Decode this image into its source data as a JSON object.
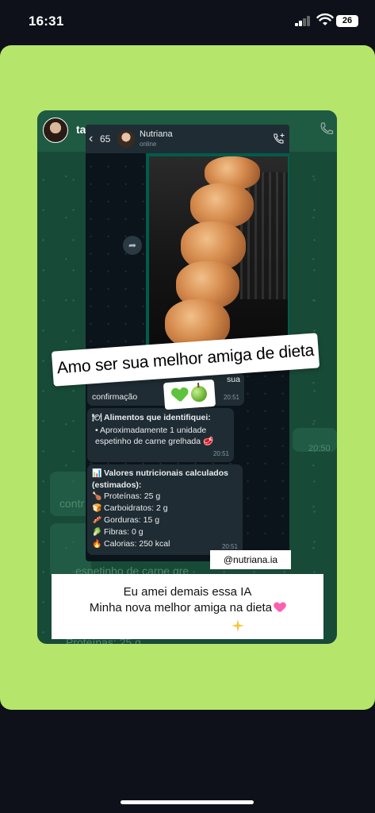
{
  "status_bar": {
    "time": "16:31",
    "battery": "26"
  },
  "story": {
    "username": "tainahvitral",
    "caption_top": "Amo ser sua melhor amiga de dieta",
    "caption_emojis": [
      "green-heart",
      "green-apple"
    ],
    "handle": "@nutriana.ia",
    "caption_bottom_line1": "Eu amei demais essa IA",
    "caption_bottom_line2": "Minha nova melhor amiga na dieta",
    "background_color": "#b5e56a"
  },
  "whatsapp_bg": {
    "back_count": "65",
    "time_right": "20:50",
    "ghost_lines": [
      "contr",
      "espetinho de carne gre",
      "Proteínas: 25 g"
    ]
  },
  "chat": {
    "back_count": "65",
    "contact_name": "Nutriana",
    "contact_status": "online",
    "confirmation": {
      "text": "confirmação",
      "suffix": "sua",
      "time": "20:51"
    },
    "foods": {
      "heading": "Alimentos que identifiquei:",
      "item": "Aproximadamente 1 unidade espetinho de carne grelhada",
      "time": "20:51"
    },
    "nutrition": {
      "heading": "Valores nutricionais calculados (estimados):",
      "rows": [
        {
          "icon": "meat-icon",
          "label": "Proteínas: 25 g"
        },
        {
          "icon": "bread-icon",
          "label": "Carboidratos: 2 g"
        },
        {
          "icon": "bacon-icon",
          "label": "Gorduras: 15 g"
        },
        {
          "icon": "leaf-icon",
          "label": "Fibras: 0 g"
        },
        {
          "icon": "fire-icon",
          "label": "Calorias: 250 kcal"
        }
      ],
      "time": "20:51"
    }
  },
  "colors": {
    "accent_green": "#00a884",
    "whatsapp_dark": "#0b141a",
    "bubble_incoming": "#1f2c33"
  }
}
